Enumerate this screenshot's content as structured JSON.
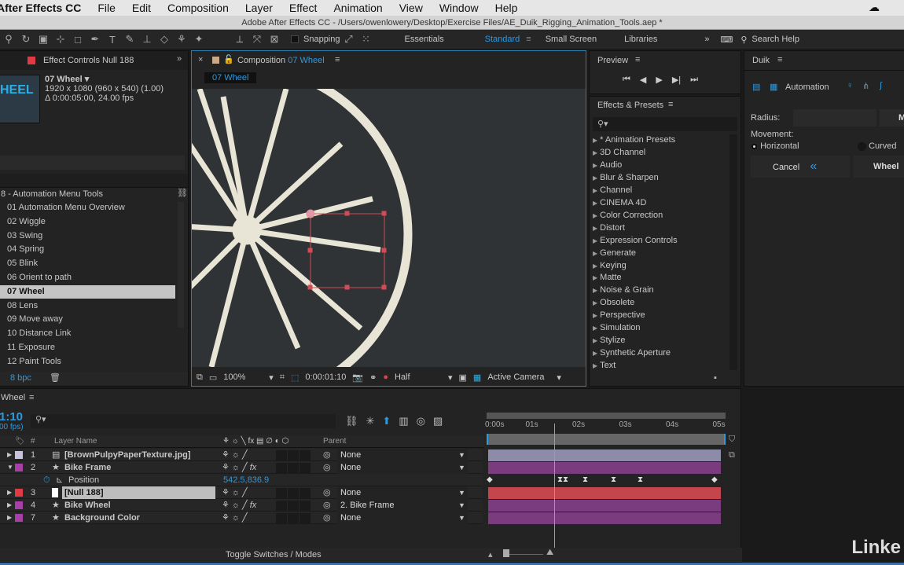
{
  "menubar": {
    "app": "After Effects CC",
    "items": [
      "File",
      "Edit",
      "Composition",
      "Layer",
      "Effect",
      "Animation",
      "View",
      "Window",
      "Help"
    ]
  },
  "window_title": "Adobe After Effects CC - /Users/owenlowery/Desktop/Exercise Files/AE_Duik_Rigging_Animation_Tools.aep *",
  "toolbar": {
    "snapping": "Snapping",
    "workspaces": [
      "Essentials",
      "Standard",
      "Small Screen",
      "Libraries"
    ],
    "active_workspace": "Standard",
    "search_help": "Search Help"
  },
  "effect_controls": {
    "tab": "Effect Controls Null 188",
    "thumb_text": "HEEL",
    "comp_name": "07 Wheel ▾",
    "resolution": "1920 x 1080  (960 x 540) (1.00)",
    "duration": "Δ 0:00:05:00, 24.00 fps"
  },
  "project": {
    "folder": "8 - Automation Menu Tools",
    "items": [
      "01 Automation Menu Overview",
      "02 Wiggle",
      "03 Swing",
      "04 Spring",
      "05 Blink",
      "06 Orient to path",
      "07 Wheel",
      "08 Lens",
      "09 Move away",
      "10 Distance Link",
      "11 Exposure",
      "12 Paint Tools"
    ],
    "selected": "07 Wheel",
    "bpc": "8 bpc"
  },
  "composition": {
    "tab_prefix": "Composition",
    "tab_name": "07 Wheel",
    "subtab": "07 Wheel",
    "zoom": "100%",
    "timecode": "0:00:01:10",
    "resolution": "Half",
    "camera": "Active Camera"
  },
  "preview": {
    "title": "Preview"
  },
  "effects_presets": {
    "title": "Effects & Presets",
    "search_placeholder": "",
    "items": [
      "* Animation Presets",
      "3D Channel",
      "Audio",
      "Blur & Sharpen",
      "Channel",
      "CINEMA 4D",
      "Color Correction",
      "Distort",
      "Expression Controls",
      "Generate",
      "Keying",
      "Matte",
      "Noise & Grain",
      "Obsolete",
      "Perspective",
      "Simulation",
      "Stylize",
      "Synthetic Aperture",
      "Text"
    ]
  },
  "duik": {
    "title": "Duik",
    "tab": "Automation",
    "radius_label": "Radius:",
    "radius_value": "",
    "m_label": "M",
    "movement_label": "Movement:",
    "horizontal": "Horizontal",
    "curved": "Curved",
    "selected_movement": "Horizontal",
    "cancel": "Cancel",
    "wheel": "Wheel"
  },
  "timeline": {
    "tab": "Wheel",
    "timecode": "1:10",
    "fps": "00 fps)",
    "col_layer_name": "Layer Name",
    "col_num": "#",
    "col_parent": "Parent",
    "ruler": [
      "0:00s",
      "01s",
      "02s",
      "03s",
      "04s",
      "05s"
    ],
    "playhead_seconds": 1.42,
    "layers": [
      {
        "num": "1",
        "name": "[BrownPulpyPaperTexture.jpg]",
        "color": "#c8c3dc",
        "parent": "None",
        "bar": "#8d8ca8",
        "expanded": false,
        "fx": false
      },
      {
        "num": "2",
        "name": "Bike Frame",
        "color": "#a63fa6",
        "parent": "None",
        "bar": "#7a3c7e",
        "expanded": true,
        "fx": true
      },
      {
        "prop": "Position",
        "value": "542.5,836.9"
      },
      {
        "num": "3",
        "name": "[Null 188]",
        "color": "#e03a45",
        "parent": "None",
        "bar": "#c4454c",
        "selected": true,
        "fx": false
      },
      {
        "num": "4",
        "name": "Bike Wheel",
        "color": "#a63fa6",
        "parent": "2. Bike Frame",
        "bar": "#7a3c7e",
        "fx": true
      },
      {
        "num": "7",
        "name": "Background Color",
        "color": "#a63fa6",
        "parent": "None",
        "bar": "#7a3c7e",
        "fx": false
      }
    ],
    "toggle": "Toggle Switches / Modes"
  },
  "watermark": "Linke",
  "colors": {
    "accent": "#2d9ae0",
    "selection": "#d24b57"
  }
}
